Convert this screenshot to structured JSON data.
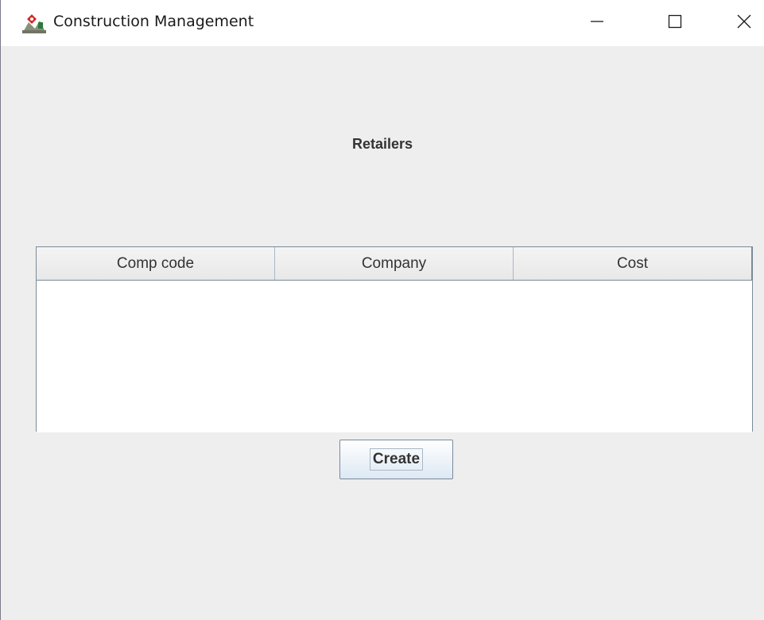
{
  "window": {
    "title": "Construction Management",
    "app_icon": "java-duke-icon",
    "controls": {
      "minimize_icon": "minimize-icon",
      "maximize_icon": "maximize-icon",
      "close_icon": "close-icon"
    }
  },
  "main": {
    "heading": "Retailers",
    "table": {
      "columns": [
        "Comp code",
        "Company",
        "Cost"
      ],
      "rows": []
    },
    "create_label": "Create"
  },
  "colors": {
    "window_background": "#eeeeee",
    "titlebar_background": "#ffffff",
    "table_border": "#7a8a99",
    "text": "#333333"
  }
}
